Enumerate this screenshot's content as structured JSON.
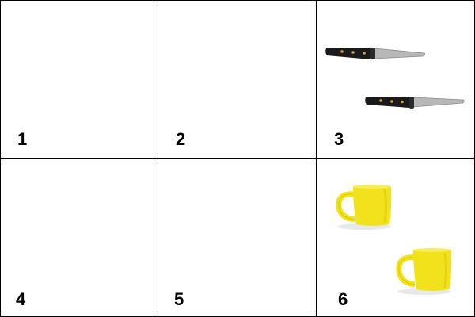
{
  "panels": [
    {
      "number": "1",
      "contents": []
    },
    {
      "number": "2",
      "contents": []
    },
    {
      "number": "3",
      "contents": [
        "knife-icon",
        "knife-icon"
      ]
    },
    {
      "number": "4",
      "contents": []
    },
    {
      "number": "5",
      "contents": []
    },
    {
      "number": "6",
      "contents": [
        "mug-icon",
        "mug-icon"
      ]
    }
  ],
  "colors": {
    "grid_line": "#000000",
    "mug_yellow": "#f2e21b",
    "knife_handle": "#1a1a1a",
    "knife_blade": "#b8b8b8",
    "rivet": "#c9a24a"
  }
}
